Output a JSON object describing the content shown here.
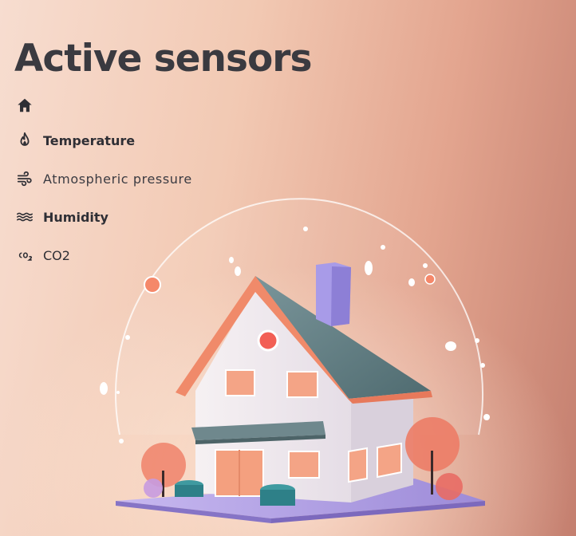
{
  "page": {
    "title": "Active sensors"
  },
  "sensors": {
    "home": {
      "icon": "home-icon"
    },
    "temperature": {
      "label": "Temperature",
      "icon": "flame-icon"
    },
    "pressure": {
      "label": "Atmospheric pressure",
      "icon": "wind-icon"
    },
    "humidity": {
      "label": "Humidity",
      "icon": "waves-icon"
    },
    "co2": {
      "label": "CO2",
      "icon": "co2-icon"
    }
  },
  "colors": {
    "text": "#2f2f35",
    "roof": "#5f7d82",
    "roof_trim": "#f08a6a",
    "chimney": "#a89be8",
    "door": "#f4a07f",
    "base": "#b7a7e6"
  }
}
